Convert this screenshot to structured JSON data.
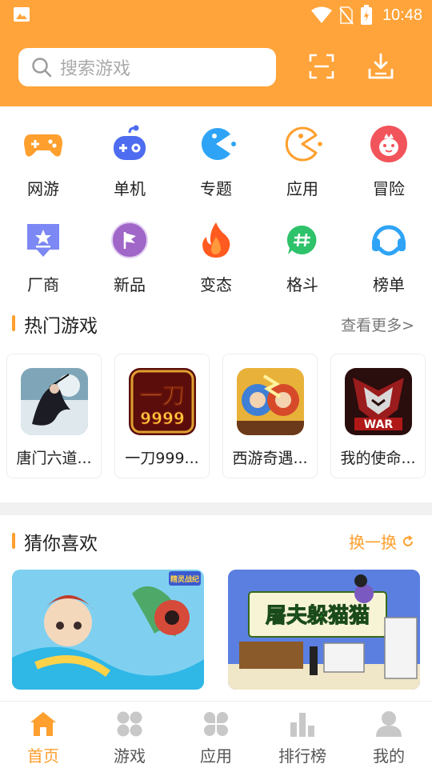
{
  "status_bar": {
    "time": "10:48"
  },
  "search": {
    "placeholder": "搜索游戏"
  },
  "categories": [
    {
      "label": "网游",
      "icon": "gamepad-icon",
      "color": "#FF9F2E"
    },
    {
      "label": "单机",
      "icon": "joystick-icon",
      "color": "#4E6CF0"
    },
    {
      "label": "专题",
      "icon": "pacman-icon",
      "color": "#2FA4F6"
    },
    {
      "label": "应用",
      "icon": "pacman-outline-icon",
      "color": "#FF9F2E"
    },
    {
      "label": "冒险",
      "icon": "mascot-icon",
      "color": "#F2545B"
    },
    {
      "label": "厂商",
      "icon": "star-badge-icon",
      "color": "#6E7BF2"
    },
    {
      "label": "新品",
      "icon": "flag-badge-icon",
      "color": "#A066C8"
    },
    {
      "label": "变态",
      "icon": "flame-icon",
      "color": "#FF5A1F"
    },
    {
      "label": "格斗",
      "icon": "hashtag-bubble-icon",
      "color": "#2EC26A"
    },
    {
      "label": "榜单",
      "icon": "headset-icon",
      "color": "#2FA4F6"
    }
  ],
  "hot_section": {
    "title": "热门游戏",
    "more": "查看更多>"
  },
  "hot_games": [
    {
      "name": "唐门六道..."
    },
    {
      "name": "一刀999..."
    },
    {
      "name": "西游奇遇..."
    },
    {
      "name": "我的使命..."
    }
  ],
  "hot_thumb_text": {
    "game2_art": "一刀",
    "game2_num": "9999",
    "game4_art": "WAR"
  },
  "guess_section": {
    "title": "猜你喜欢",
    "swap": "换一换"
  },
  "recommend": [
    {
      "name_partial": "精灵战纪",
      "art_text": "精灵战纪"
    },
    {
      "name_partial": "屠夫躲猫猫",
      "art_text": "屠夫躲猫猫"
    }
  ],
  "tabs": [
    {
      "label": "首页",
      "active": true
    },
    {
      "label": "游戏",
      "active": false
    },
    {
      "label": "应用",
      "active": false
    },
    {
      "label": "排行榜",
      "active": false
    },
    {
      "label": "我的",
      "active": false
    }
  ],
  "colors": {
    "brand": "#FFA43A",
    "accent": "#FF9F2E"
  }
}
